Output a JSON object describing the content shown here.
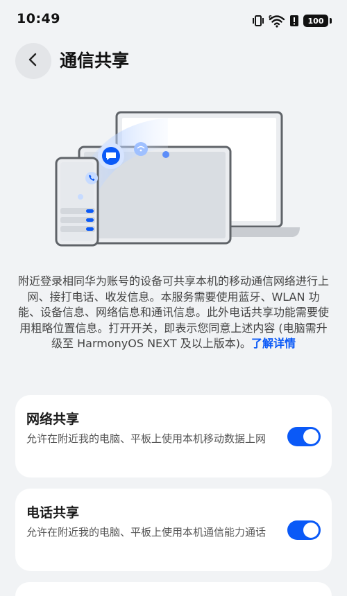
{
  "status_bar": {
    "time": "10:49",
    "battery": "100",
    "icons": [
      "vibrate-icon",
      "wifi-6-icon",
      "alert-icon",
      "battery-icon"
    ]
  },
  "header": {
    "title": "通信共享",
    "back_icon": "chevron-left-icon"
  },
  "illustration": {
    "icons": [
      "chat-bubble-icon",
      "wifi-share-icon",
      "phone-call-icon"
    ],
    "colors": {
      "accent": "#0a59f7",
      "device_frame": "#5f6368",
      "screen": "#d9dde2"
    }
  },
  "description": {
    "text": "附近登录相同华为账号的设备可共享本机的移动通信网络进行上网、接打电话、收发信息。本服务需要使用蓝牙、WLAN 功能、设备信息、网络信息和通讯信息。此外电话共享功能需要使用粗略位置信息。打开开关，即表示您同意上述内容 (电脑需升级至 HarmonyOS NEXT 及以上版本)。",
    "link": "了解详情"
  },
  "settings": [
    {
      "title": "网络共享",
      "description": "允许在附近我的电脑、平板上使用本机移动数据上网",
      "enabled": true
    },
    {
      "title": "电话共享",
      "description": "允许在附近我的电脑、平板上使用本机通信能力通话",
      "enabled": true
    }
  ],
  "colors": {
    "accent": "#0a59f7",
    "background": "#f1f3f5",
    "card": "#ffffff"
  }
}
